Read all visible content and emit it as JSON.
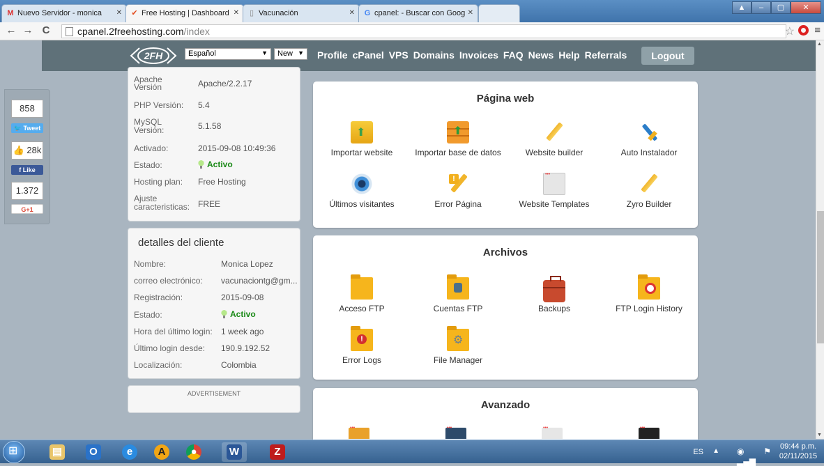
{
  "browser": {
    "tabs": [
      {
        "title": "Nuevo Servidor - monica",
        "icon": "gmail-icon"
      },
      {
        "title": "Free Hosting | Dashboard",
        "icon": "2fh-favicon-icon"
      },
      {
        "title": "Vacunación",
        "icon": "page-icon"
      },
      {
        "title": "cpanel: - Buscar con Goog",
        "icon": "google-icon"
      }
    ],
    "url_host": "cpanel.2freehosting.com",
    "url_path": "/index"
  },
  "header": {
    "logo_text": "2FH",
    "language": "Español",
    "new_select": "New",
    "nav": [
      "Profile",
      "cPanel",
      "VPS",
      "Domains",
      "Invoices",
      "FAQ",
      "News",
      "Help",
      "Referrals"
    ],
    "logout": "Logout"
  },
  "social": {
    "tweet_count": "858",
    "tweet": "Tweet",
    "fb_count": "28k",
    "like": "Like",
    "gplus_count": "1.372",
    "gplus": "G+1"
  },
  "server_info": {
    "rows": [
      {
        "label": "Apache Versión",
        "value": "Apache/2.2.17"
      },
      {
        "label": "PHP Versión:",
        "value": "5.4"
      },
      {
        "label": "MySQL Versión:",
        "value": "5.1.58"
      },
      {
        "label": "Activado:",
        "value": "2015-09-08 10:49:36"
      },
      {
        "label": "Estado:",
        "value": "Activo"
      },
      {
        "label": "Hosting plan:",
        "value": "Free Hosting"
      },
      {
        "label": "Ajuste caracteristicas:",
        "value": "FREE"
      }
    ]
  },
  "client": {
    "title": "detalles del cliente",
    "rows": [
      {
        "label": "Nombre:",
        "value": "Monica Lopez"
      },
      {
        "label": "correo electrónico:",
        "value": "vacunaciontg@gm..."
      },
      {
        "label": "Registración:",
        "value": "2015-09-08"
      },
      {
        "label": "Estado:",
        "value": "Activo"
      },
      {
        "label": "Hora del último login:",
        "value": "1 week ago"
      },
      {
        "label": "Último login desde:",
        "value": "190.9.192.52"
      },
      {
        "label": "Localización:",
        "value": "Colombia"
      }
    ]
  },
  "advertisement": "ADVERTISEMENT",
  "website_section": {
    "title": "Página web",
    "tools": [
      "Importar website",
      "Importar base de datos",
      "Website builder",
      "Auto Instalador",
      "Últimos visitantes",
      "Error Página",
      "Website Templates",
      "Zyro Builder"
    ]
  },
  "files_section": {
    "title": "Archivos",
    "tools": [
      "Acceso FTP",
      "Cuentas FTP",
      "Backups",
      "FTP Login History",
      "Error Logs",
      "File Manager"
    ]
  },
  "advanced_section": {
    "title": "Avanzado"
  },
  "taskbar": {
    "lang": "ES",
    "time": "09:44 p.m.",
    "date": "02/11/2015"
  }
}
